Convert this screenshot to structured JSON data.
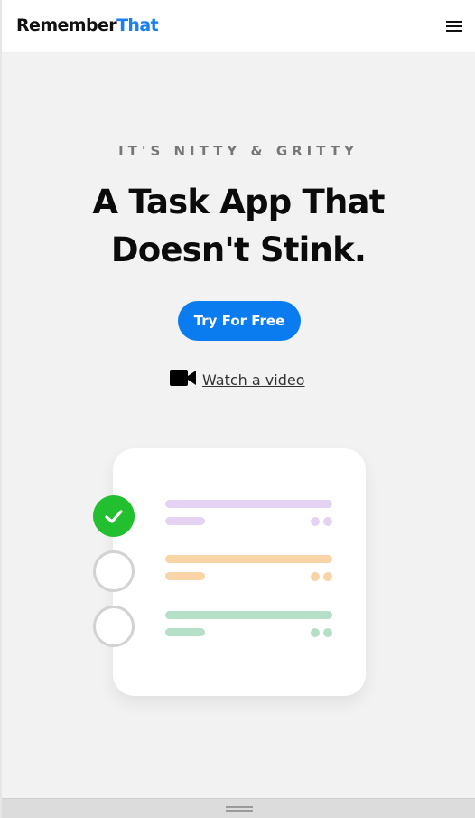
{
  "header": {
    "logo_part1": "Remember",
    "logo_part2": "That",
    "logo_colors": {
      "part1": "#111111",
      "part2": "#1a7ff0"
    },
    "menu_icon": "hamburger-menu-icon"
  },
  "hero": {
    "eyebrow": "IT'S NITTY & GRITTY",
    "headline": "A Task App That Doesn't Stink.",
    "cta_label": "Try For Free",
    "cta_color": "#0a7cf0",
    "video_icon": "video-camera-icon",
    "video_label": "Watch a video"
  },
  "illustration": {
    "tasks": [
      {
        "status": "done",
        "check_icon": "checkmark-icon",
        "bar_color": "#e5d3f3",
        "status_color": "#22c02e"
      },
      {
        "status": "todo",
        "bar_color": "#f9d4a6"
      },
      {
        "status": "todo",
        "bar_color": "#b6dfc9"
      }
    ]
  },
  "bottom_bar": {
    "handle_icon": "drag-handle-icon"
  }
}
